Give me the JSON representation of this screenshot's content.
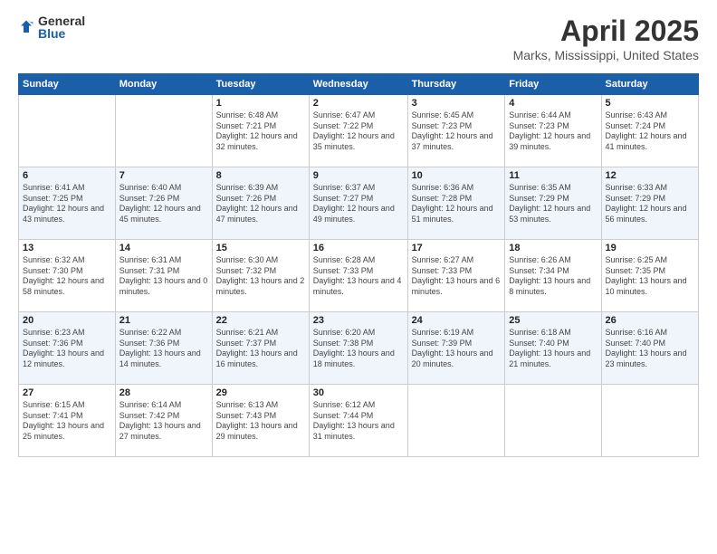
{
  "logo": {
    "general": "General",
    "blue": "Blue"
  },
  "title": "April 2025",
  "subtitle": "Marks, Mississippi, United States",
  "days_of_week": [
    "Sunday",
    "Monday",
    "Tuesday",
    "Wednesday",
    "Thursday",
    "Friday",
    "Saturday"
  ],
  "weeks": [
    [
      {
        "day": "",
        "info": ""
      },
      {
        "day": "",
        "info": ""
      },
      {
        "day": "1",
        "info": "Sunrise: 6:48 AM\nSunset: 7:21 PM\nDaylight: 12 hours and 32 minutes."
      },
      {
        "day": "2",
        "info": "Sunrise: 6:47 AM\nSunset: 7:22 PM\nDaylight: 12 hours and 35 minutes."
      },
      {
        "day": "3",
        "info": "Sunrise: 6:45 AM\nSunset: 7:23 PM\nDaylight: 12 hours and 37 minutes."
      },
      {
        "day": "4",
        "info": "Sunrise: 6:44 AM\nSunset: 7:23 PM\nDaylight: 12 hours and 39 minutes."
      },
      {
        "day": "5",
        "info": "Sunrise: 6:43 AM\nSunset: 7:24 PM\nDaylight: 12 hours and 41 minutes."
      }
    ],
    [
      {
        "day": "6",
        "info": "Sunrise: 6:41 AM\nSunset: 7:25 PM\nDaylight: 12 hours and 43 minutes."
      },
      {
        "day": "7",
        "info": "Sunrise: 6:40 AM\nSunset: 7:26 PM\nDaylight: 12 hours and 45 minutes."
      },
      {
        "day": "8",
        "info": "Sunrise: 6:39 AM\nSunset: 7:26 PM\nDaylight: 12 hours and 47 minutes."
      },
      {
        "day": "9",
        "info": "Sunrise: 6:37 AM\nSunset: 7:27 PM\nDaylight: 12 hours and 49 minutes."
      },
      {
        "day": "10",
        "info": "Sunrise: 6:36 AM\nSunset: 7:28 PM\nDaylight: 12 hours and 51 minutes."
      },
      {
        "day": "11",
        "info": "Sunrise: 6:35 AM\nSunset: 7:29 PM\nDaylight: 12 hours and 53 minutes."
      },
      {
        "day": "12",
        "info": "Sunrise: 6:33 AM\nSunset: 7:29 PM\nDaylight: 12 hours and 56 minutes."
      }
    ],
    [
      {
        "day": "13",
        "info": "Sunrise: 6:32 AM\nSunset: 7:30 PM\nDaylight: 12 hours and 58 minutes."
      },
      {
        "day": "14",
        "info": "Sunrise: 6:31 AM\nSunset: 7:31 PM\nDaylight: 13 hours and 0 minutes."
      },
      {
        "day": "15",
        "info": "Sunrise: 6:30 AM\nSunset: 7:32 PM\nDaylight: 13 hours and 2 minutes."
      },
      {
        "day": "16",
        "info": "Sunrise: 6:28 AM\nSunset: 7:33 PM\nDaylight: 13 hours and 4 minutes."
      },
      {
        "day": "17",
        "info": "Sunrise: 6:27 AM\nSunset: 7:33 PM\nDaylight: 13 hours and 6 minutes."
      },
      {
        "day": "18",
        "info": "Sunrise: 6:26 AM\nSunset: 7:34 PM\nDaylight: 13 hours and 8 minutes."
      },
      {
        "day": "19",
        "info": "Sunrise: 6:25 AM\nSunset: 7:35 PM\nDaylight: 13 hours and 10 minutes."
      }
    ],
    [
      {
        "day": "20",
        "info": "Sunrise: 6:23 AM\nSunset: 7:36 PM\nDaylight: 13 hours and 12 minutes."
      },
      {
        "day": "21",
        "info": "Sunrise: 6:22 AM\nSunset: 7:36 PM\nDaylight: 13 hours and 14 minutes."
      },
      {
        "day": "22",
        "info": "Sunrise: 6:21 AM\nSunset: 7:37 PM\nDaylight: 13 hours and 16 minutes."
      },
      {
        "day": "23",
        "info": "Sunrise: 6:20 AM\nSunset: 7:38 PM\nDaylight: 13 hours and 18 minutes."
      },
      {
        "day": "24",
        "info": "Sunrise: 6:19 AM\nSunset: 7:39 PM\nDaylight: 13 hours and 20 minutes."
      },
      {
        "day": "25",
        "info": "Sunrise: 6:18 AM\nSunset: 7:40 PM\nDaylight: 13 hours and 21 minutes."
      },
      {
        "day": "26",
        "info": "Sunrise: 6:16 AM\nSunset: 7:40 PM\nDaylight: 13 hours and 23 minutes."
      }
    ],
    [
      {
        "day": "27",
        "info": "Sunrise: 6:15 AM\nSunset: 7:41 PM\nDaylight: 13 hours and 25 minutes."
      },
      {
        "day": "28",
        "info": "Sunrise: 6:14 AM\nSunset: 7:42 PM\nDaylight: 13 hours and 27 minutes."
      },
      {
        "day": "29",
        "info": "Sunrise: 6:13 AM\nSunset: 7:43 PM\nDaylight: 13 hours and 29 minutes."
      },
      {
        "day": "30",
        "info": "Sunrise: 6:12 AM\nSunset: 7:44 PM\nDaylight: 13 hours and 31 minutes."
      },
      {
        "day": "",
        "info": ""
      },
      {
        "day": "",
        "info": ""
      },
      {
        "day": "",
        "info": ""
      }
    ]
  ]
}
